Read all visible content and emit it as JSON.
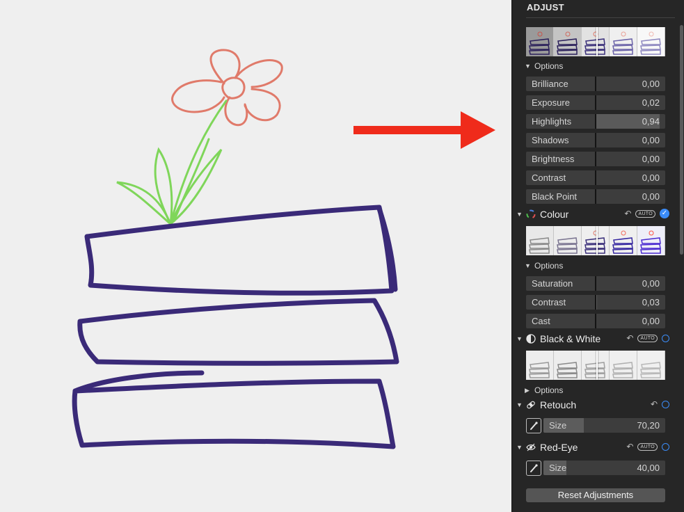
{
  "panel": {
    "title": "ADJUST",
    "light": {
      "options_label": "Options",
      "sliders": [
        {
          "label": "Brilliance",
          "value": "0,00",
          "fill": 0
        },
        {
          "label": "Exposure",
          "value": "0,02",
          "fill": 0.01
        },
        {
          "label": "Highlights",
          "value": "0,94",
          "fill": 0.92
        },
        {
          "label": "Shadows",
          "value": "0,00",
          "fill": 0
        },
        {
          "label": "Brightness",
          "value": "0,00",
          "fill": 0
        },
        {
          "label": "Contrast",
          "value": "0,00",
          "fill": 0
        },
        {
          "label": "Black Point",
          "value": "0,00",
          "fill": 0
        }
      ]
    },
    "colour": {
      "title": "Colour",
      "auto_label": "AUTO",
      "options_label": "Options",
      "sliders": [
        {
          "label": "Saturation",
          "value": "0,00",
          "fill": 0
        },
        {
          "label": "Contrast",
          "value": "0,03",
          "fill": 0.02
        },
        {
          "label": "Cast",
          "value": "0,00",
          "fill": 0
        }
      ]
    },
    "black_white": {
      "title": "Black & White",
      "auto_label": "AUTO",
      "options_label": "Options"
    },
    "retouch": {
      "title": "Retouch",
      "size_label": "Size",
      "size_value": "70,20",
      "size_fill": 0.33
    },
    "red_eye": {
      "title": "Red-Eye",
      "auto_label": "AUTO",
      "size_label": "Size",
      "size_value": "40,00",
      "size_fill": 0.19
    },
    "reset_label": "Reset Adjustments"
  },
  "colors": {
    "accent": "#3b8cf7",
    "arrow": "#ef2b1b",
    "crayon_purple": "#3a2a78",
    "crayon_red": "#e07a6a",
    "crayon_green": "#7fd65a"
  },
  "icons": {
    "colour": "colour-wheel-icon",
    "black_white": "half-circle-icon",
    "retouch": "bandage-icon",
    "red_eye": "eye-icon",
    "brush": "brush-icon",
    "undo": "undo-icon"
  }
}
